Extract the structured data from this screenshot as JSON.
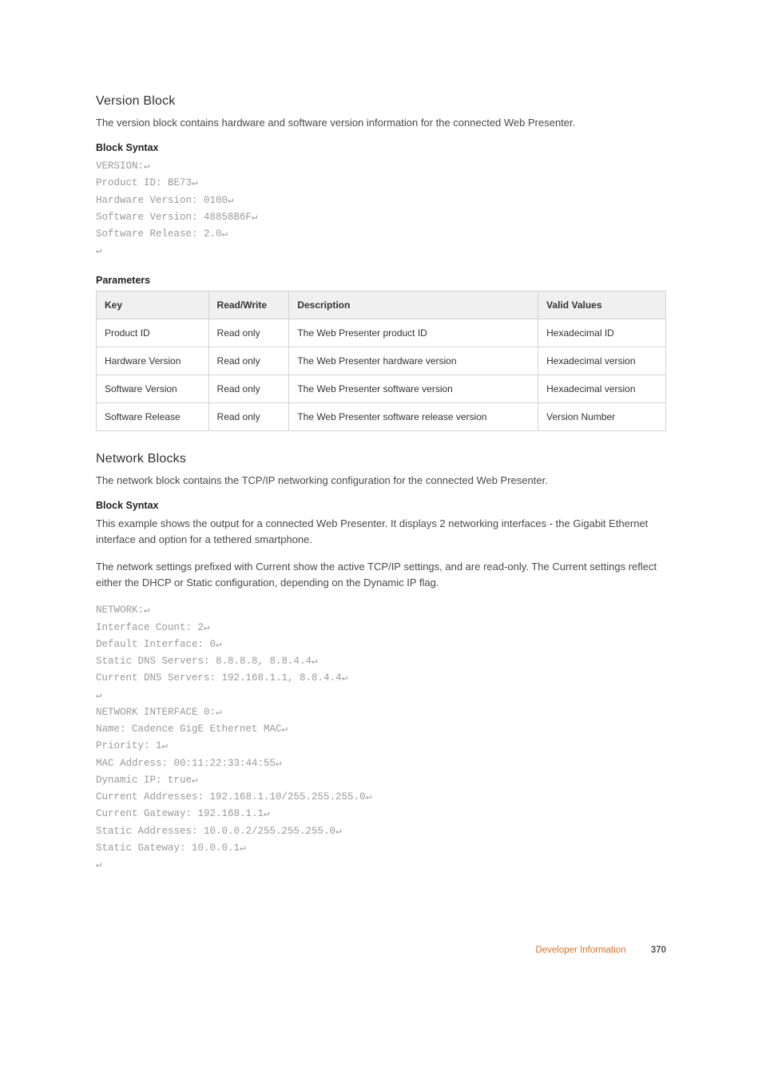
{
  "section1": {
    "title": "Version Block",
    "intro": "The version block contains hardware and software version information for the connected Web Presenter.",
    "block_syntax_label": "Block Syntax",
    "code": {
      "l1": "VERSION:",
      "l2": "Product ID: BE73",
      "l3": "Hardware Version: 0100",
      "l4": "Software Version: 48858B6F",
      "l5": "Software Release: 2.0"
    },
    "parameters_label": "Parameters",
    "table": {
      "headers": {
        "c1": "Key",
        "c2": "Read/Write",
        "c3": "Description",
        "c4": "Valid Values"
      },
      "rows": [
        {
          "c1": "Product ID",
          "c2": "Read only",
          "c3": "The Web Presenter product ID",
          "c4": "Hexadecimal ID"
        },
        {
          "c1": "Hardware Version",
          "c2": "Read only",
          "c3": "The Web Presenter hardware version",
          "c4": "Hexadecimal version"
        },
        {
          "c1": "Software Version",
          "c2": "Read only",
          "c3": "The Web Presenter software version",
          "c4": "Hexadecimal version"
        },
        {
          "c1": "Software Release",
          "c2": "Read only",
          "c3": "The Web Presenter software release version",
          "c4": "Version Number"
        }
      ]
    }
  },
  "section2": {
    "title": "Network Blocks",
    "intro": "The network block contains the TCP/IP networking configuration for the connected Web Presenter.",
    "block_syntax_label": "Block Syntax",
    "para1": "This example shows the output for a connected Web Presenter. It displays 2 networking interfaces - the Gigabit Ethernet interface and option for a tethered smartphone.",
    "para2": "The network settings prefixed with Current show the active TCP/IP settings, and are read-only. The Current settings reflect either the DHCP or Static configuration, depending on the Dynamic IP flag.",
    "code": {
      "l1": "NETWORK:",
      "l2": "Interface Count: 2",
      "l3": "Default Interface: 0",
      "l4": "Static DNS Servers: 8.8.8.8, 8.8.4.4",
      "l5": "Current DNS Servers: 192.168.1.1, 8.8.4.4",
      "l6": "",
      "l7": "NETWORK INTERFACE 0:",
      "l8": "Name: Cadence GigE Ethernet MAC",
      "l9": "Priority: 1",
      "l10": "MAC Address: 00:11:22:33:44:55",
      "l11": "Dynamic IP: true",
      "l12": "Current Addresses: 192.168.1.10/255.255.255.0",
      "l13": "Current Gateway: 192.168.1.1",
      "l14": "Static Addresses: 10.0.0.2/255.255.255.0",
      "l15": "Static Gateway: 10.0.0.1"
    }
  },
  "footer": {
    "label": "Developer Information",
    "page": "370"
  },
  "glyph": {
    "cr": "↵"
  }
}
